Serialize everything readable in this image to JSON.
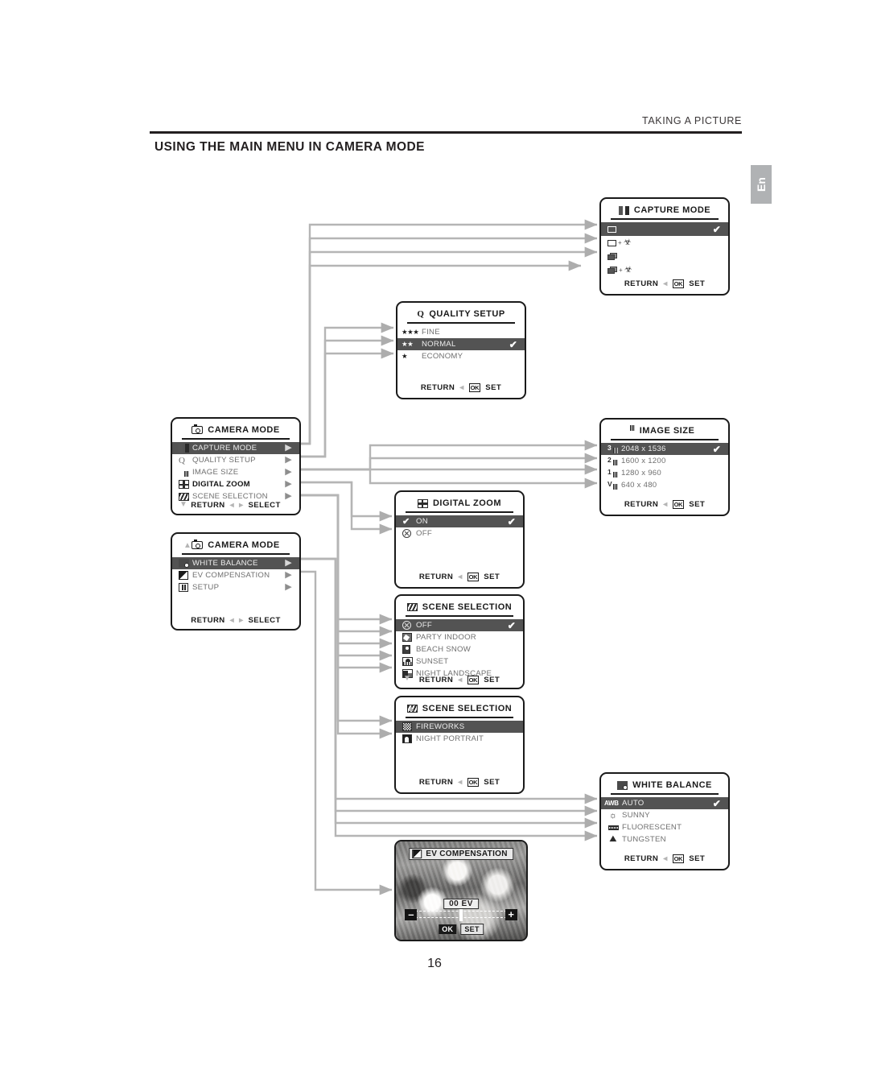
{
  "page": {
    "header_right": "TAKING A PICTURE",
    "title": "USING THE MAIN MENU IN CAMERA MODE",
    "lang_tab": "En",
    "page_number": "16"
  },
  "common": {
    "return_label": "RETURN",
    "set_label": "SET",
    "select_label": "SELECT",
    "ok_label": "OK",
    "check_mark": "✔",
    "left_arrow": "◂",
    "right_arrow": "▸",
    "down_arrow": "▼",
    "up_arrow": "▲",
    "caret_right": "▶",
    "line_color": "#b3b3b3",
    "highlight_color": "#535353"
  },
  "screens": {
    "capture_mode": {
      "title": "CAPTURE MODE",
      "icon": "capture-mode-icon",
      "items": [
        {
          "label": "",
          "icon": "single-frame-icon",
          "selected": true,
          "checked": true
        },
        {
          "label": "",
          "icon": "single-frame-macro-icon",
          "selected": false,
          "checked": false
        },
        {
          "label": "",
          "icon": "burst-frames-icon",
          "selected": false,
          "checked": false
        },
        {
          "label": "",
          "icon": "burst-frames-macro-icon",
          "selected": false,
          "checked": false
        }
      ]
    },
    "quality_setup": {
      "title": "QUALITY  SETUP",
      "icon": "quality-q-icon",
      "items": [
        {
          "label": "FINE",
          "stars": "★★★",
          "selected": false,
          "checked": false
        },
        {
          "label": "NORMAL",
          "stars": "★★",
          "selected": true,
          "checked": true
        },
        {
          "label": "ECONOMY",
          "stars": "★",
          "selected": false,
          "checked": false
        }
      ]
    },
    "camera_mode_1": {
      "title": "CAMERA MODE",
      "icon": "camera-icon",
      "items": [
        {
          "label": "CAPTURE MODE",
          "icon": "capture-mode-icon",
          "selected": true,
          "bold": false
        },
        {
          "label": "QUALITY SETUP",
          "icon": "quality-q-icon",
          "selected": false,
          "bold": false
        },
        {
          "label": "IMAGE SIZE",
          "icon": "image-size-icon",
          "selected": false,
          "bold": false
        },
        {
          "label": "DIGITAL ZOOM",
          "icon": "digital-zoom-icon",
          "selected": false,
          "bold": true
        },
        {
          "label": "SCENE SELECTION",
          "icon": "scene-selection-icon",
          "selected": false,
          "bold": false
        }
      ]
    },
    "camera_mode_2": {
      "title": "CAMERA MODE",
      "icon": "camera-icon",
      "items": [
        {
          "label": "WHITE BALANCE",
          "icon": "white-balance-icon",
          "selected": true,
          "bold": false
        },
        {
          "label": "EV COMPENSATION",
          "icon": "ev-compensation-icon",
          "selected": false,
          "bold": false
        },
        {
          "label": "SETUP",
          "icon": "setup-icon",
          "selected": false,
          "bold": false
        }
      ]
    },
    "image_size": {
      "title": "IMAGE SIZE",
      "icon": "image-size-icon",
      "items": [
        {
          "label": "2048 x 1536",
          "badge": "3",
          "selected": true,
          "checked": true
        },
        {
          "label": "1600 x 1200",
          "badge": "2",
          "selected": false,
          "checked": false
        },
        {
          "label": "1280 x 960",
          "badge": "1",
          "selected": false,
          "checked": false
        },
        {
          "label": "640 x 480",
          "badge": "V",
          "selected": false,
          "checked": false
        }
      ]
    },
    "digital_zoom": {
      "title": "DIGITAL  ZOOM",
      "icon": "digital-zoom-icon",
      "items": [
        {
          "label": "ON",
          "icon": "check-icon",
          "selected": true,
          "checked": true
        },
        {
          "label": "OFF",
          "icon": "circle-x-icon",
          "selected": false,
          "checked": false
        }
      ]
    },
    "scene_selection_1": {
      "title": "SCENE  SELECTION",
      "icon": "scene-selection-icon",
      "items": [
        {
          "label": "OFF",
          "icon": "circle-x-icon",
          "selected": true,
          "checked": true
        },
        {
          "label": "PARTY INDOOR",
          "icon": "party-indoor-icon",
          "selected": false,
          "checked": false
        },
        {
          "label": "BEACH SNOW",
          "icon": "beach-snow-icon",
          "selected": false,
          "checked": false
        },
        {
          "label": "SUNSET",
          "icon": "sunset-icon",
          "selected": false,
          "checked": false
        },
        {
          "label": "NIGHT LANDSCAPE",
          "icon": "night-landscape-icon",
          "selected": false,
          "checked": false
        }
      ]
    },
    "scene_selection_2": {
      "title": "SCENE  SELECTION",
      "icon": "scene-selection-icon",
      "items": [
        {
          "label": "FIREWORKS",
          "icon": "fireworks-icon",
          "selected": true,
          "checked": false
        },
        {
          "label": "NIGHT PORTRAIT",
          "icon": "night-portrait-icon",
          "selected": false,
          "checked": false
        }
      ]
    },
    "white_balance": {
      "title": "WHITE BALANCE",
      "icon": "white-balance-icon",
      "items": [
        {
          "label": "AUTO",
          "badge": "AWB",
          "selected": true,
          "checked": true
        },
        {
          "label": "SUNNY",
          "icon": "sunny-icon",
          "selected": false,
          "checked": false
        },
        {
          "label": "FLUORESCENT",
          "icon": "fluorescent-icon",
          "selected": false,
          "checked": false
        },
        {
          "label": "TUNGSTEN",
          "icon": "tungsten-icon",
          "selected": false,
          "checked": false
        }
      ]
    },
    "ev_compensation": {
      "title": "EV COMPENSATION",
      "icon": "ev-compensation-icon",
      "value": "00 EV",
      "minus": "–",
      "plus": "+",
      "ok_label": "OK",
      "set_label": "SET"
    }
  }
}
